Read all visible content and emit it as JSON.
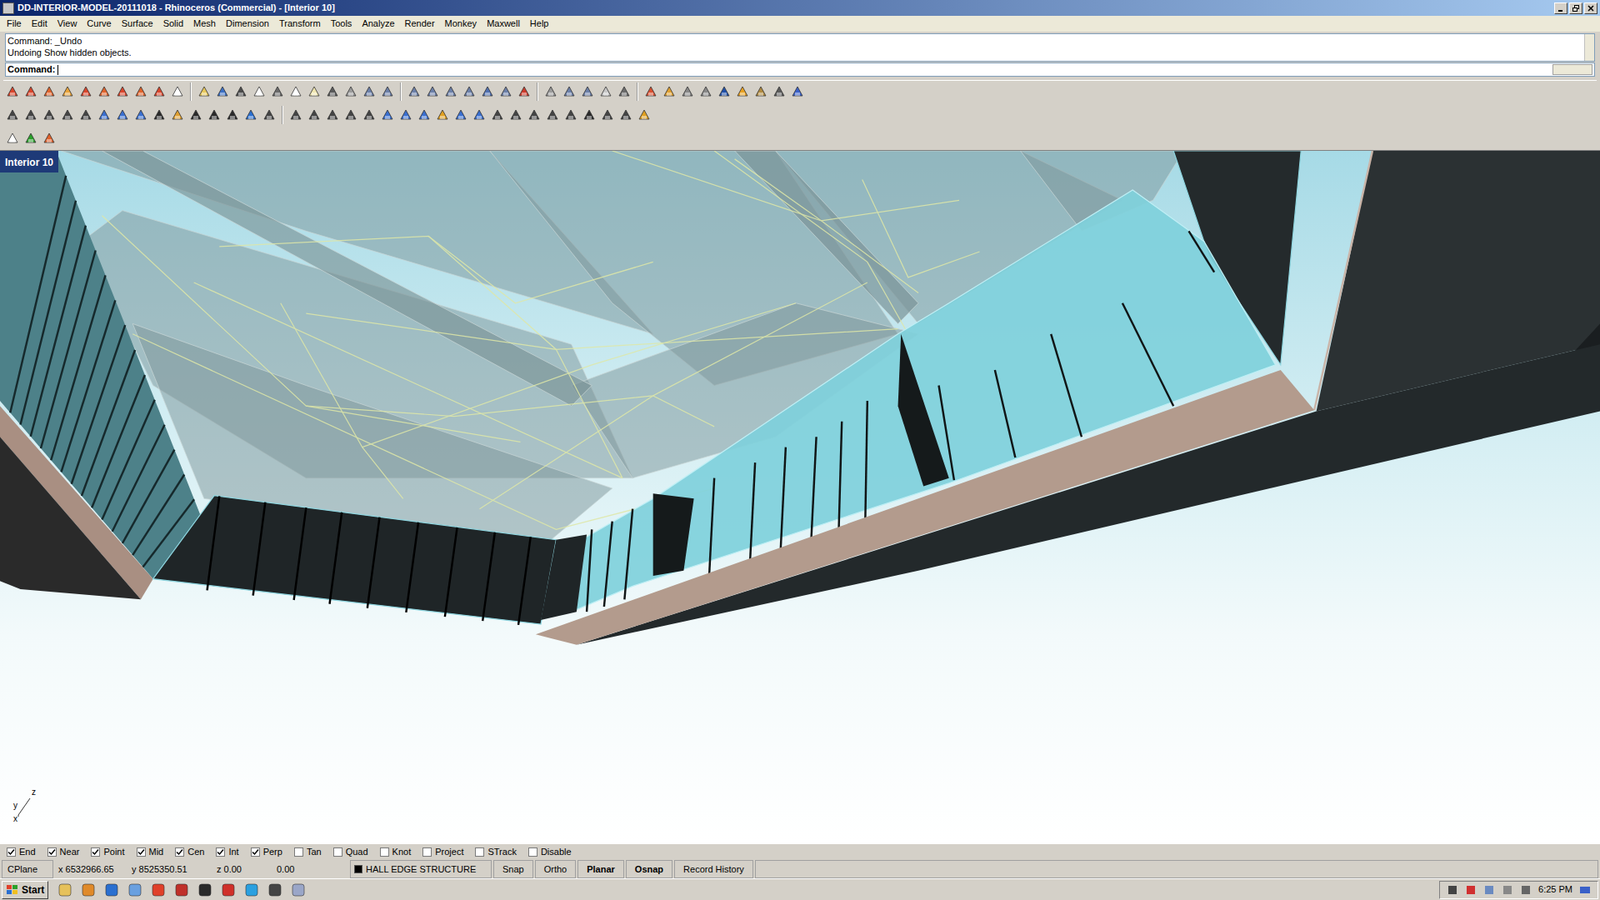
{
  "window": {
    "title": "DD-INTERIOR-MODEL-20111018 - Rhinoceros (Commercial) - [Interior 10]"
  },
  "menu": [
    "File",
    "Edit",
    "View",
    "Curve",
    "Surface",
    "Solid",
    "Mesh",
    "Dimension",
    "Transform",
    "Tools",
    "Analyze",
    "Render",
    "Monkey",
    "Maxwell",
    "Help"
  ],
  "command_history": [
    "Command: _Undo",
    "Undoing Show hidden objects."
  ],
  "command_prompt": {
    "label": "Command:"
  },
  "viewport": {
    "label": "Interior 10",
    "axes": [
      "z",
      "y",
      "x"
    ]
  },
  "osnaps": [
    {
      "label": "End",
      "checked": true
    },
    {
      "label": "Near",
      "checked": true
    },
    {
      "label": "Point",
      "checked": true
    },
    {
      "label": "Mid",
      "checked": true
    },
    {
      "label": "Cen",
      "checked": true
    },
    {
      "label": "Int",
      "checked": true
    },
    {
      "label": "Perp",
      "checked": true
    },
    {
      "label": "Tan",
      "checked": false
    },
    {
      "label": "Quad",
      "checked": false
    },
    {
      "label": "Knot",
      "checked": false
    },
    {
      "label": "Project",
      "checked": false
    },
    {
      "label": "STrack",
      "checked": false
    },
    {
      "label": "Disable",
      "checked": false
    }
  ],
  "status_bar": {
    "cplane": "CPlane",
    "x": "x 6532966.65",
    "y": "y 8525350.51",
    "z": "z 0.00",
    "distance": "0.00",
    "layer": {
      "name": "HALL EDGE STRUCTURE",
      "color": "#000000"
    },
    "toggles": [
      {
        "label": "Snap",
        "on": false
      },
      {
        "label": "Ortho",
        "on": false
      },
      {
        "label": "Planar",
        "on": true
      },
      {
        "label": "Osnap",
        "on": true
      },
      {
        "label": "Record History",
        "on": false
      }
    ]
  },
  "taskbar": {
    "start": "Start",
    "time": "6:25 PM"
  }
}
